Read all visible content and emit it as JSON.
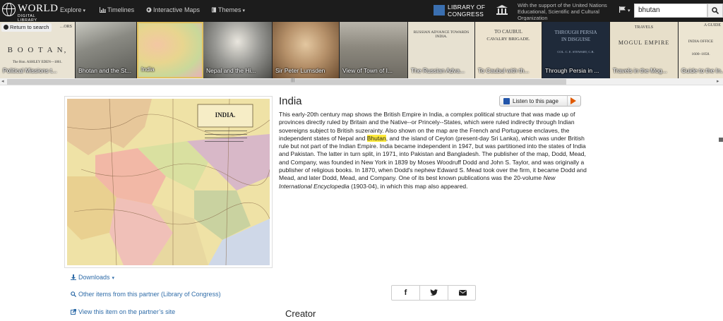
{
  "topbar": {
    "logo_word": "WORLD",
    "logo_sub": "DIGITAL LIBRARY",
    "nav": [
      {
        "label": "Explore",
        "icon": "",
        "caret": true
      },
      {
        "label": "Timelines",
        "icon": "bar-chart-icon",
        "caret": false
      },
      {
        "label": "Interactive Maps",
        "icon": "globe-icon",
        "caret": false
      },
      {
        "label": "Themes",
        "icon": "book-icon",
        "caret": true
      }
    ],
    "loc_line1": "LIBRARY OF",
    "loc_line2": "CONGRESS",
    "support_text": "With the support of the United Nations Educational, Scientific and Cultural Organization",
    "search_value": "bhutan"
  },
  "return_label": "Return to search",
  "thumbnails": [
    {
      "caption": "Political Missions t...",
      "title_lines": [
        "…ORS",
        "B O O T A N,",
        "The Hon. ASHLEY EDEN—1861."
      ],
      "bg": "#e9e3d3"
    },
    {
      "caption": "Bhotan and the St...",
      "title_lines": [],
      "bg": "#8a8a83"
    },
    {
      "caption": "India",
      "title_lines": [],
      "bg": "#e8d58f"
    },
    {
      "caption": "Nepal and the Hi...",
      "title_lines": [],
      "bg": "#9a9a96"
    },
    {
      "caption": "Sir Peter Lumsden",
      "title_lines": [],
      "bg": "#b6916a"
    },
    {
      "caption": "View of Town of I...",
      "title_lines": [],
      "bg": "#6d6a62"
    },
    {
      "caption": "The Russian Adva...",
      "title_lines": [
        "RUSSIAN ADVANCE TOWARDS INDIA."
      ],
      "bg": "#e7e1d1"
    },
    {
      "caption": "To Caubul with th...",
      "title_lines": [
        "TO CAUBUL",
        "CAVALRY BRIGADE."
      ],
      "bg": "#ece3cf"
    },
    {
      "caption": "Through Persia in ...",
      "title_lines": [
        "THROUGH PERSIA",
        "IN DISGUISE",
        "COL. C. E. STEWART, C.B."
      ],
      "bg": "#1f2a3a"
    },
    {
      "caption": "Travels in the Mog...",
      "title_lines": [
        "TRAVELS",
        "MOGUL EMPIRE"
      ],
      "bg": "#e7dfca"
    },
    {
      "caption": "Guide to the In...",
      "title_lines": [
        "A GUIDE",
        "INDIA OFFICE",
        "1600–1858."
      ],
      "bg": "#ece5d2"
    }
  ],
  "item": {
    "title": "India",
    "listen_label": "Listen to this page",
    "desc_before": "This early-20th century map shows the British Empire in India, a complex political structure that was made up of provinces directly ruled by Britain and the Native--or Princely--States, which were ruled indirectly through Indian sovereigns subject to British suzerainty. Also shown on the map are the French and Portuguese enclaves, the independent states of Nepal and ",
    "desc_highlight": "Bhutan",
    "desc_middle": ", and the island of Ceylon (present-day Sri Lanka), which was under British rule but not part of the Indian Empire. India became independent in 1947, but was partitioned into the states of India and Pakistan. The latter in turn split, in 1971, into Pakistan and Bangladesh. The publisher of the map, Dodd, Mead, and Company, was founded in New York in 1839 by Moses Woodruff Dodd and John S. Taylor, and was originally a publisher of religious books. In 1870, when Dodd's nephew Edward S. Mead took over the firm, it became Dodd and Mead, and later Dodd, Mead, and Company. One of its best known publications was the 20-volume ",
    "desc_italic": "New International Encyclopedia",
    "desc_after": " (1903-04), in which this map also appeared.",
    "map_title": "INDIA."
  },
  "side_links": {
    "downloads": "Downloads",
    "other_items": "Other items from this partner (Library of Congress)",
    "view_partner": "View this item on the partner’s site"
  },
  "share": {
    "facebook": "f",
    "twitter": "twitter-icon",
    "email": "email-icon"
  },
  "creator_heading": "Creator",
  "colors": {
    "link": "#2f6ca8",
    "topbar": "#1c1c1c",
    "highlight": "#ffeb3b",
    "listen_play": "#e05a00"
  }
}
